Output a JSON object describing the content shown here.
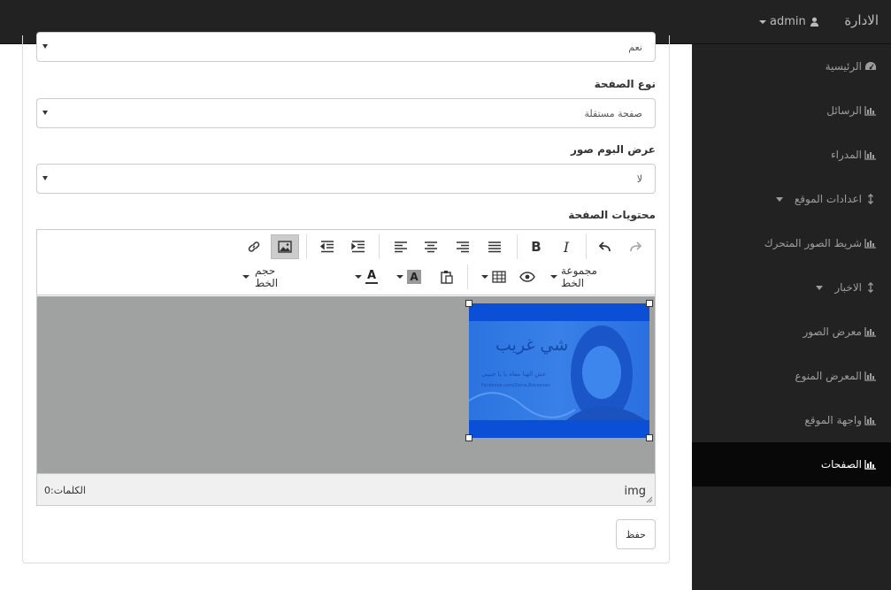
{
  "topbar": {
    "brand": "الادارة",
    "user": "admin"
  },
  "sidebar": {
    "items": [
      {
        "label": "الرئيسية",
        "icon": "dashboard-icon"
      },
      {
        "label": "الرسائل",
        "icon": "bar-chart-icon"
      },
      {
        "label": "المدراء",
        "icon": "bar-chart-icon"
      },
      {
        "label": "اعدادات الموقع",
        "icon": "vertical-arrows-icon"
      },
      {
        "label": "شريط الصور المتحرك",
        "icon": "bar-chart-icon"
      },
      {
        "label": "الاخبار",
        "icon": "vertical-arrows-icon"
      },
      {
        "label": "معرض الصور",
        "icon": "bar-chart-icon"
      },
      {
        "label": "المعرض المنوع",
        "icon": "bar-chart-icon"
      },
      {
        "label": "واجهة الموقع",
        "icon": "bar-chart-icon"
      },
      {
        "label": "الصفحات",
        "icon": "bar-chart-icon"
      }
    ]
  },
  "form": {
    "top_select_value": "نعم",
    "page_type_label": "نوع الصفحة",
    "page_type_value": "صفحة مستقلة",
    "album_label": "عرض البوم صور",
    "album_value": "لا",
    "content_label": "محتويات الصفحة",
    "save_label": "حفظ"
  },
  "editor": {
    "font_family_label": "مجموعة الخط",
    "font_size_label": "حجم الخط",
    "path": "img",
    "word_count": "الكلمات:0",
    "image_text_title": "شي غريب",
    "image_text_sub": "عش الهنا معاه يا يا حبيبي",
    "image_text_link": "Facebook.com/Zeina.Bousenan"
  }
}
